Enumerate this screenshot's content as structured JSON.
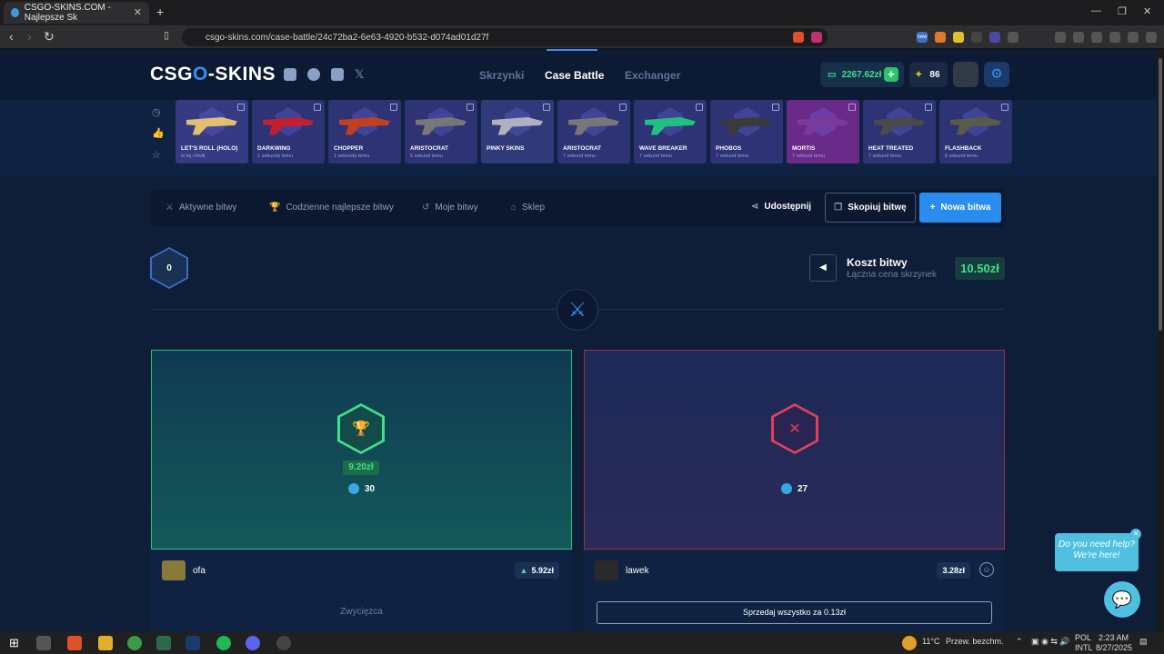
{
  "browser": {
    "tab_title": "CSGO-SKINS.COM - Najlepsze Sk",
    "url": "csgo-skins.com/case-battle/24c72ba2-6e63-4920-b532-d074ad01d27f",
    "new_badge": "new"
  },
  "header": {
    "logo_left": "CSG",
    "logo_o": "O",
    "logo_right": "-SKINS",
    "nav": [
      "Skrzynki",
      "Case Battle",
      "Exchanger"
    ],
    "balance": "2267.62zł",
    "coins": "86"
  },
  "cases": [
    {
      "name": "LET'S ROLL (HOLO)",
      "sub": "w tej chwili",
      "color": "#353a82"
    },
    {
      "name": "DARKWING",
      "sub": "1 sekundę temu",
      "color": "#2d3374"
    },
    {
      "name": "CHOPPER",
      "sub": "1 sekundę temu",
      "color": "#2d3374"
    },
    {
      "name": "ARISTOCRAT",
      "sub": "5 sekund temu",
      "color": "#2d3374"
    },
    {
      "name": "PINKY SKINS",
      "sub": "",
      "color": "#303a7a"
    },
    {
      "name": "ARISTOCRAT",
      "sub": "7 sekund temu",
      "color": "#2d3374"
    },
    {
      "name": "WAVE BREAKER",
      "sub": "7 sekund temu",
      "color": "#2d3374"
    },
    {
      "name": "PHOBOS",
      "sub": "7 sekund temu",
      "color": "#2d3374"
    },
    {
      "name": "MORTIS",
      "sub": "7 sekund temu",
      "color": "#6a2a8a"
    },
    {
      "name": "HEAT TREATED",
      "sub": "7 sekund temu",
      "color": "#2d3374"
    },
    {
      "name": "FLASHBACK",
      "sub": "8 sekund temu",
      "color": "#2d3374"
    }
  ],
  "toolbar": {
    "active": "Aktywne bitwy",
    "daily": "Codzienne najlepsze bitwy",
    "mine": "Moje bitwy",
    "shop": "Sklep",
    "share": "Udostępnij",
    "copy": "Skopiuj bitwę",
    "new": "Nowa bitwa"
  },
  "battle": {
    "round": "0",
    "cost_title": "Koszt bitwy",
    "cost_sub": "Łączna cena skrzynek",
    "cost_value": "10.50zł"
  },
  "players": [
    {
      "name": "ofa",
      "win_amount": "9.20zł",
      "points": "30",
      "total": "5.92zł",
      "status": "Zwycięzca"
    },
    {
      "name": "lawek",
      "points": "27",
      "total": "3.28zł",
      "sell_all": "Sprzedaj wszystko za 0.13zł"
    }
  ],
  "chat": {
    "bubble": "Do you need help? We're here!"
  },
  "taskbar": {
    "weather": "11°C",
    "weather_text": "Przew. bezchm.",
    "lang1": "POL",
    "lang2": "INTL",
    "time": "2:23 AM",
    "date": "8/27/2025"
  },
  "colors": {
    "accent": "#3a8ff0",
    "win_green": "#3fe08a",
    "lose_red": "#e0405a"
  }
}
